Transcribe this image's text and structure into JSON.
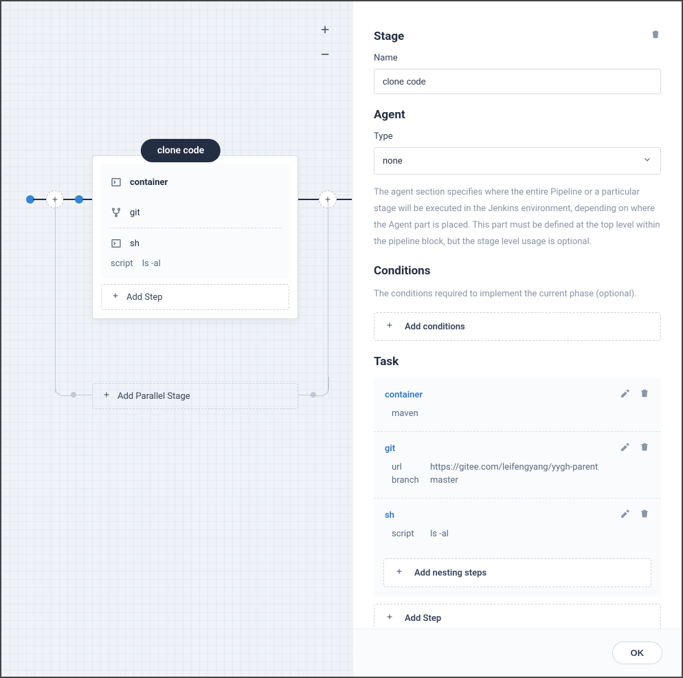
{
  "canvas": {
    "stage_pill": "clone code",
    "steps": [
      {
        "name": "container",
        "icon": "terminal"
      },
      {
        "name": "git",
        "icon": "branch"
      },
      {
        "name": "sh",
        "icon": "terminal",
        "param_key": "script",
        "param_value": "ls -al"
      }
    ],
    "add_step": "Add Step",
    "add_parallel": "Add Parallel Stage"
  },
  "panel": {
    "stage_title": "Stage",
    "name_label": "Name",
    "name_value": "clone code",
    "agent_title": "Agent",
    "type_label": "Type",
    "type_value": "none",
    "agent_help": "The agent section specifies where the entire Pipeline or a particular stage will be executed in the Jenkins environment, depending on where the Agent part is placed. This part must be defined at the top level within the pipeline block, but the stage level usage is optional.",
    "conditions_title": "Conditions",
    "conditions_help": "The conditions required to implement the current phase (optional).",
    "add_conditions": "Add conditions",
    "task_title": "Task",
    "tasks": [
      {
        "name": "container",
        "params": [
          {
            "key": "",
            "value": "maven"
          }
        ]
      },
      {
        "name": "git",
        "params": [
          {
            "key": "url",
            "value": "https://gitee.com/leifengyang/yygh-parent"
          },
          {
            "key": "branch",
            "value": "master"
          }
        ]
      },
      {
        "name": "sh",
        "params": [
          {
            "key": "script",
            "value": "ls -al"
          }
        ]
      }
    ],
    "add_nesting": "Add nesting steps",
    "add_step": "Add Step",
    "ok": "OK"
  }
}
